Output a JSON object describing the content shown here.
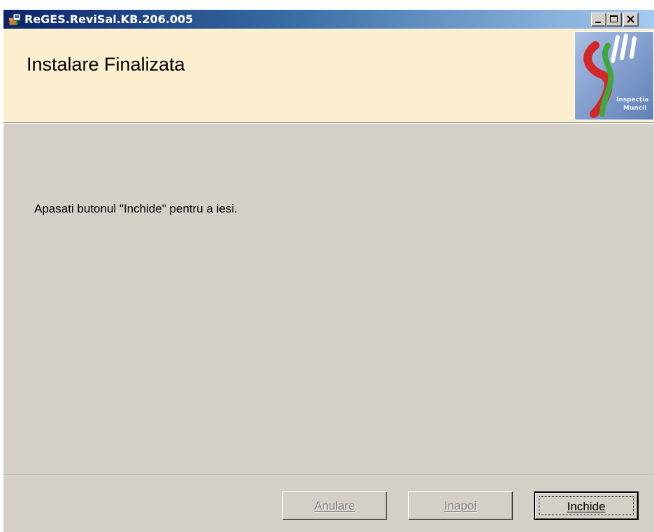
{
  "window": {
    "title": "ReGES.ReviSal.KB.206.005"
  },
  "header": {
    "title": "Instalare Finalizata",
    "logo_text_line1": "Inspecția",
    "logo_text_line2": "Muncii"
  },
  "main": {
    "message": "Apasati butonul \"Inchide\" pentru a iesi."
  },
  "buttons": {
    "cancel": {
      "label": "Anulare",
      "enabled": false
    },
    "back": {
      "label": "Inapoi",
      "enabled": false
    },
    "close": {
      "label": "Inchide",
      "enabled": true,
      "default": true
    }
  },
  "colors": {
    "title_gradient_start": "#0a246a",
    "title_gradient_end": "#a6caf0",
    "header_background": "#fcefcf",
    "window_background": "#d4d0c8"
  }
}
